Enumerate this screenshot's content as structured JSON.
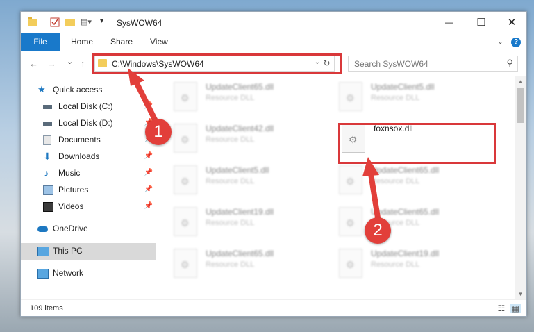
{
  "window": {
    "title": "SysWOW64",
    "controls": {
      "minimize": "—",
      "maximize": "☐",
      "close": "✕"
    }
  },
  "ribbon": {
    "tabs": [
      "File",
      "Home",
      "Share",
      "View"
    ],
    "help_label": "?",
    "collapse_icon": "chevron-down-icon"
  },
  "navigation": {
    "back": "←",
    "forward": "→",
    "recent": "⌄",
    "up": "↑",
    "address": "C:\\Windows\\SysWOW64",
    "search_placeholder": "Search SysWOW64"
  },
  "sidebar": {
    "items": [
      {
        "label": "Quick access",
        "icon": "star-icon",
        "pinned": false
      },
      {
        "label": "Local Disk (C:)",
        "icon": "drive-icon",
        "pinned": true
      },
      {
        "label": "Local Disk (D:)",
        "icon": "drive-icon",
        "pinned": true
      },
      {
        "label": "Documents",
        "icon": "documents-icon",
        "pinned": true
      },
      {
        "label": "Downloads",
        "icon": "downloads-icon",
        "pinned": true
      },
      {
        "label": "Music",
        "icon": "music-icon",
        "pinned": true
      },
      {
        "label": "Pictures",
        "icon": "pictures-icon",
        "pinned": true
      },
      {
        "label": "Videos",
        "icon": "videos-icon",
        "pinned": true
      },
      {
        "label": "OneDrive",
        "icon": "onedrive-icon",
        "pinned": false
      },
      {
        "label": "This PC",
        "icon": "computer-icon",
        "pinned": false,
        "selected": true
      },
      {
        "label": "Network",
        "icon": "network-icon",
        "pinned": false
      }
    ]
  },
  "files": [
    {
      "name": "UpdateClient65.dll",
      "type": "Resource DLL",
      "blurred": true
    },
    {
      "name": "UpdateClient5.dll",
      "type": "Resource DLL",
      "blurred": true
    },
    {
      "name": "UpdateClient42.dll",
      "type": "Resource DLL",
      "blurred": true
    },
    {
      "name": "foxnsox.dll",
      "type": "",
      "blurred": false
    },
    {
      "name": "UpdateClient5.dll",
      "type": "Resource DLL",
      "blurred": true
    },
    {
      "name": "UpdateClient65.dll",
      "type": "Resource DLL",
      "blurred": true
    },
    {
      "name": "UpdateClient19.dll",
      "type": "Resource DLL",
      "blurred": true
    },
    {
      "name": "UpdateClient65.dll",
      "type": "Resource DLL",
      "blurred": true
    },
    {
      "name": "UpdateClient65.dll",
      "type": "Resource DLL",
      "blurred": true
    },
    {
      "name": "UpdateClient19.dll",
      "type": "Resource DLL",
      "blurred": true
    }
  ],
  "status": {
    "item_count": "109 items"
  },
  "annotations": {
    "badge1": "1",
    "badge2": "2",
    "color": "#e23f3a"
  }
}
